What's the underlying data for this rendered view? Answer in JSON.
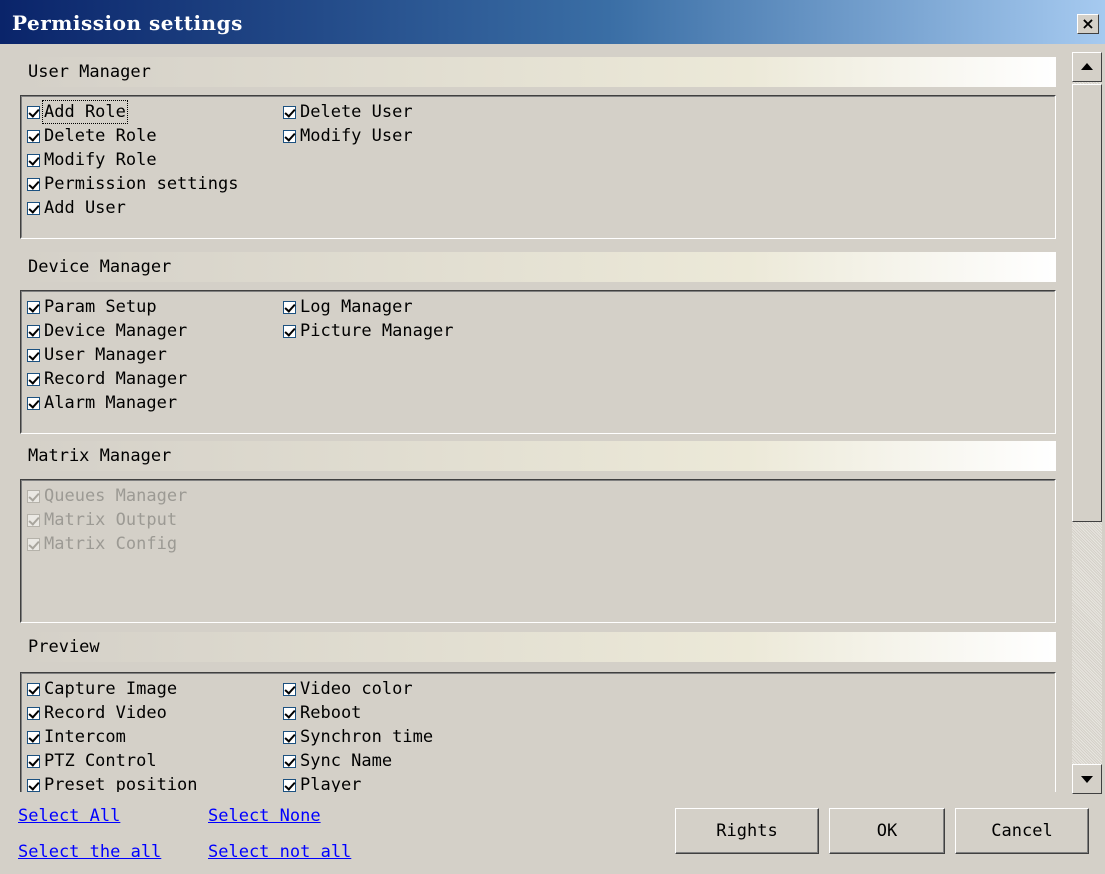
{
  "window": {
    "title": "Permission settings",
    "close_label": "×"
  },
  "sections": {
    "user_manager": {
      "header": "User Manager",
      "col1": [
        "Add Role",
        "Delete Role",
        "Modify Role",
        "Permission settings",
        "Add User"
      ],
      "col2": [
        "Delete User",
        "Modify User"
      ]
    },
    "device_manager": {
      "header": "Device Manager",
      "col1": [
        "Param Setup",
        "Device Manager",
        "User Manager",
        "Record Manager",
        "Alarm Manager"
      ],
      "col2": [
        "Log Manager",
        "Picture Manager"
      ]
    },
    "matrix_manager": {
      "header": "Matrix Manager",
      "col1": [
        "Queues Manager",
        "Matrix Output",
        "Matrix Config"
      ]
    },
    "preview": {
      "header": "Preview",
      "col1": [
        "Capture Image",
        "Record Video",
        "Intercom",
        "PTZ Control",
        "Preset position"
      ],
      "col2": [
        "Video color",
        "Reboot",
        "Synchron time",
        "Sync Name",
        "Player"
      ]
    }
  },
  "links": {
    "select_all": "Select All",
    "select_none": "Select None",
    "select_the_all": "Select the all",
    "select_not_all": "Select not all"
  },
  "buttons": {
    "rights": "Rights",
    "ok": "OK",
    "cancel": "Cancel"
  },
  "colors": {
    "title_start": "#0a246a",
    "title_end": "#a6caf0",
    "link": "#0000ff",
    "face": "#d4d0c8"
  }
}
